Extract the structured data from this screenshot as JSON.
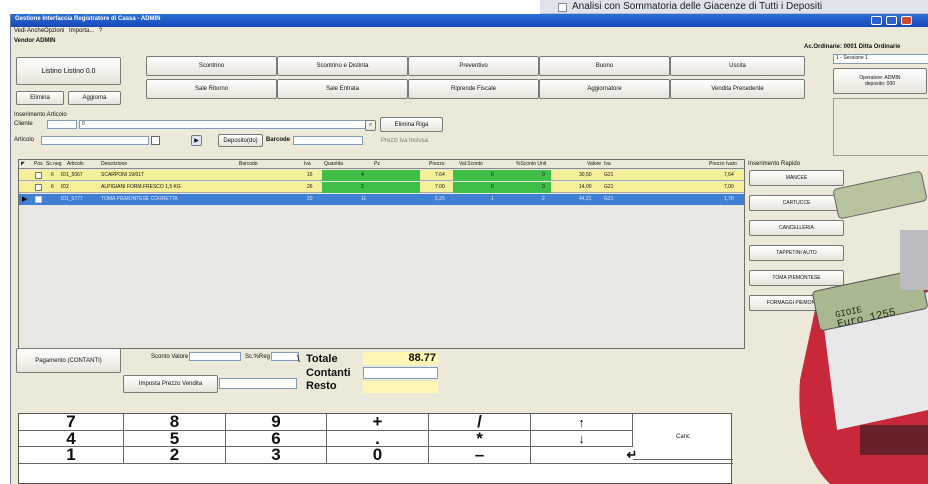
{
  "bg_banner": {
    "text": "Analisi con Sommatoria delle Giacenze di Tutti i Depositi"
  },
  "window": {
    "title": "Gestione Interfaccia Registratore di Cassa - ADMIN",
    "menu": [
      "Vedi Anche",
      "Opzioni",
      "Importa...",
      "?"
    ],
    "operator": "Vendor ADMIN",
    "order_info": "Ac.Ordinarie: 0001 Ditta Ordinarie"
  },
  "toolbar": {
    "left_buttons": [
      "Listino Listino 0.0",
      "Elimina",
      "Aggiorna"
    ],
    "top_row": [
      "Scontrino",
      "Scontrino e Distinta",
      "Preventivo",
      "Buono",
      "Uscita"
    ],
    "second_row": [
      "Sale Ritorno",
      "Sale Entrata",
      "Riprende Fiscale",
      "Aggiornatore",
      "Vendita Precedente"
    ]
  },
  "right_panel": {
    "select_value": "1 - Sessione 1",
    "info": [
      "Operatore: ADMIN",
      "deposito: 000"
    ]
  },
  "inserimento": {
    "section_label": "Inserimento Articolo",
    "cliente_label": "Cliente",
    "cliente_value": "0",
    "articolo_label": "Articolo",
    "deposito_button": "Deposito(do)",
    "barcode_label": "Barcode",
    "elimina_riga_button": "Elimina Riga",
    "prezzi_label": "Prezzi Iva Inclusa"
  },
  "table": {
    "headers": [
      "Pos",
      "Sc.neg",
      "Articolo",
      "Descrizione",
      "Barcode",
      "Iva",
      "Quantita",
      "Pz",
      "Prezzo",
      "Val.Sconto",
      "%Sconto Unit",
      "Valore",
      "Iva",
      "Prezzo Ivato"
    ],
    "rows": [
      {
        "pos": "",
        "sc": "6",
        "articolo": "ID1_5067",
        "descrizione": "SCARPONI 19/01T",
        "iva": "16",
        "quantita": "4",
        "prezzo": "7.64",
        "valsconto": "0",
        "sconto": "0",
        "valore": "30,50",
        "ivacode": "G21",
        "prezzo_ivato": "7,64"
      },
      {
        "pos": "",
        "sc": "6",
        "articolo": "ID2",
        "descrizione": "ALPIGIANI FORM.FRESCO 1,5 KG",
        "iva": "26",
        "quantita": "2",
        "prezzo": "7.00",
        "valsconto": "0",
        "sconto": "0",
        "valore": "14,00",
        "ivacode": "G21",
        "prezzo_ivato": "7,00"
      },
      {
        "pos": "",
        "sc": "",
        "articolo": "ID1_5777",
        "descrizione": "TOMA PIEMONTESE CORRETTA",
        "iva": "20",
        "quantita": "11",
        "prezzo": "5,25",
        "valsconto": "1",
        "sconto": "2",
        "valore": "44,21",
        "ivacode": "G21",
        "prezzo_ivato": "1,70"
      }
    ]
  },
  "quick_insert": {
    "label": "Inserimento Rapido",
    "items": [
      "MANCEE",
      "CARTUCCE",
      "CANCELLERIA",
      "TAPPETINI AUTO",
      "TOMA PIEMONTESE",
      "FORMAGGI PIEMONTESI"
    ]
  },
  "payment": {
    "pagamento_button": "Pagamento (CONTANTI)",
    "sconto_label": "Sconto Valore",
    "sconto_pct_label": "Sc.%Reg",
    "imposta_button": "Imposta Prezzo Vendita",
    "totale_label": "Totale",
    "totale_prefix": "\\",
    "totale_value": "88.77",
    "contanti_label": "Contanti",
    "resto_label": "Resto"
  },
  "keypad": {
    "keys": [
      "7",
      "8",
      "9",
      "+",
      "/",
      "↑",
      "4",
      "5",
      "6",
      ".",
      "*",
      "↓",
      "1",
      "2",
      "3",
      "0",
      "–",
      "↵"
    ],
    "canc": "Canc"
  },
  "register_display": {
    "line1": "GIOIE",
    "line2": "Euro 1255"
  }
}
